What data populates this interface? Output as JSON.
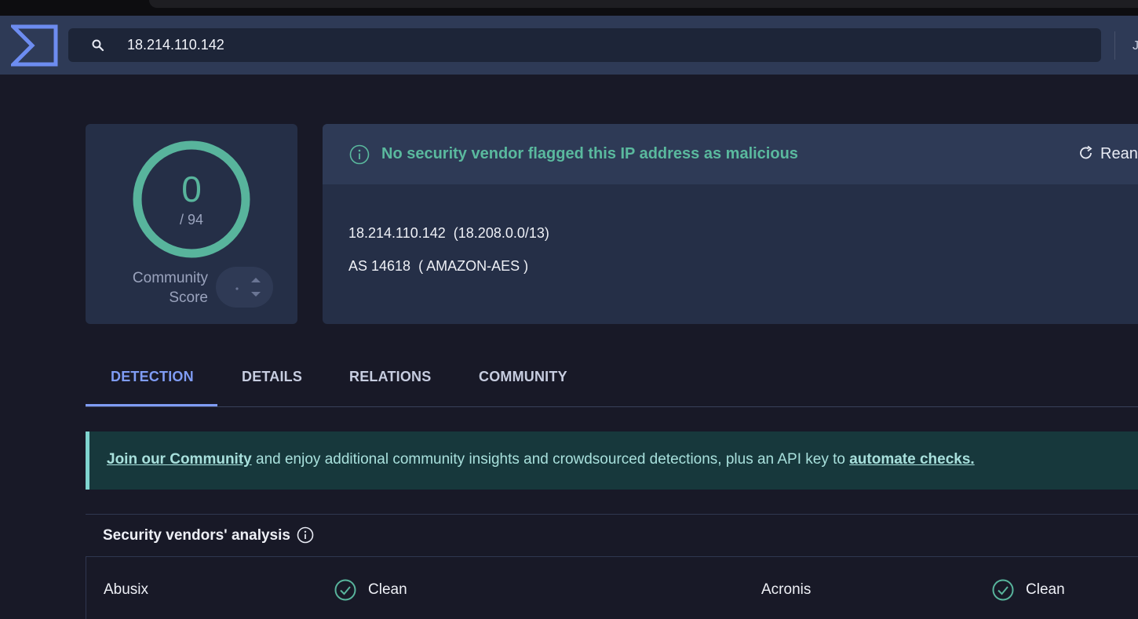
{
  "search": {
    "value": "18.214.110.142"
  },
  "header": {
    "cut_text": "J"
  },
  "score": {
    "detections": "0",
    "total": "/ 94",
    "community_label_line1": "Community",
    "community_label_line2": "Score"
  },
  "banner": {
    "message": "No security vendor flagged this IP address as malicious",
    "reanalyze_label": "Rean"
  },
  "ip_info": {
    "ip_line": "18.214.110.142  (18.208.0.0/13)",
    "as_line": "AS 14618  ( AMAZON-AES )"
  },
  "tabs": [
    "DETECTION",
    "DETAILS",
    "RELATIONS",
    "COMMUNITY"
  ],
  "join_banner": {
    "link1": "Join our Community",
    "text": " and enjoy additional community insights and crowdsourced detections, plus an API key to ",
    "link2": "automate checks."
  },
  "vendors": {
    "title": "Security vendors' analysis",
    "rows": [
      {
        "left_name": "Abusix",
        "left_result": "Clean",
        "right_name": "Acronis",
        "right_result": "Clean"
      }
    ]
  },
  "colors": {
    "accent": "#7f9cf4",
    "clean": "#58b49c",
    "header": "#2e3a56",
    "background": "#181927"
  }
}
